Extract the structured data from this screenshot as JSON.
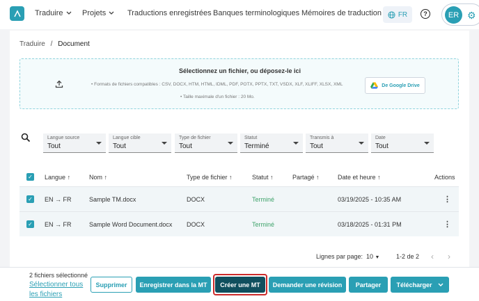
{
  "nav": {
    "items": [
      {
        "label": "Traduire",
        "dropdown": true
      },
      {
        "label": "Projets",
        "dropdown": true
      },
      {
        "label": "Traductions enregistrées"
      },
      {
        "label": "Banques terminologiques"
      },
      {
        "label": "Mémoires de traduction"
      }
    ],
    "language": "FR",
    "avatar_initials": "ER"
  },
  "breadcrumb": {
    "parent": "Traduire",
    "separator": "/",
    "current": "Document"
  },
  "upload": {
    "title": "Sélectionnez un fichier, ou déposez-le ici",
    "formats": "Formats de fichiers compatibles : CSV, DOCX, HTM, HTML, IDML, PDF, POTX, PPTX, TXT, VSDX, XLF, XLIFF, XLSX, XML",
    "max_size": "Taille maximale d'un fichier : 20 Mo.",
    "google_drive_label": "De Google Drive"
  },
  "filters": [
    {
      "label": "Langue source",
      "value": "Tout"
    },
    {
      "label": "Langue cible",
      "value": "Tout"
    },
    {
      "label": "Type de fichier",
      "value": "Tout"
    },
    {
      "label": "Statut",
      "value": "Terminé"
    },
    {
      "label": "Transmis à",
      "value": "Tout"
    },
    {
      "label": "Date",
      "value": "Tout"
    }
  ],
  "table": {
    "headers": {
      "langue": "Langue",
      "nom": "Nom",
      "type": "Type de fichier",
      "statut": "Statut",
      "partage": "Partagé",
      "date": "Date et heure",
      "actions": "Actions"
    },
    "rows": [
      {
        "source": "EN",
        "target": "FR",
        "name": "Sample TM.docx",
        "type": "DOCX",
        "status": "Terminé",
        "date": "03/19/2025 - 10:35 AM",
        "checked": true
      },
      {
        "source": "EN",
        "target": "FR",
        "name": "Sample Word Document.docx",
        "type": "DOCX",
        "status": "Terminé",
        "date": "03/18/2025 - 01:31 PM",
        "checked": true
      }
    ]
  },
  "pagination": {
    "rows_per_page_label": "Lignes par page:",
    "rows_per_page": "10",
    "range": "1-2 de 2"
  },
  "bottom_bar": {
    "selected_count": "2 fichiers sélectionné",
    "select_all": "Sélectionner tous les fichiers",
    "delete": "Supprimer",
    "save_mt": "Enregistrer dans la MT",
    "create_mt": "Créer une MT",
    "request_review": "Demander une révision",
    "share": "Partager",
    "download": "Télécharger"
  },
  "colors": {
    "accent": "#2a9fb4",
    "dark": "#104f5e",
    "success": "#3fa36b",
    "highlight": "#cc2a2a"
  }
}
